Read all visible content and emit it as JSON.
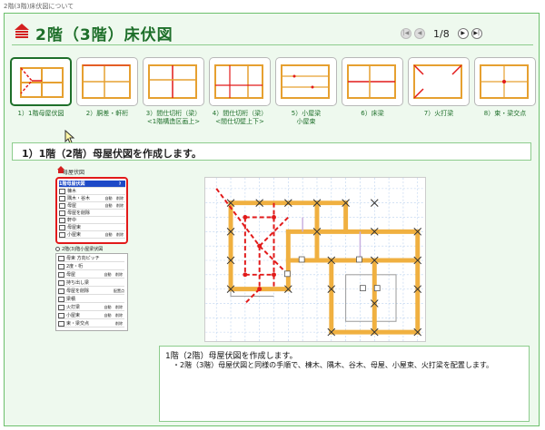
{
  "window": {
    "title": "2階(3階)床伏図について"
  },
  "header": {
    "title": "2階（3階）床伏図"
  },
  "pager": {
    "text": "1/8"
  },
  "thumbnails": [
    {
      "label": "1）1階母屋伏図"
    },
    {
      "label": "2）胴差・軒桁"
    },
    {
      "label": "3）間仕切桁（梁）\n<1階構造区画上>"
    },
    {
      "label": "4）間仕切桁（梁）\n<間仕切壁上下>"
    },
    {
      "label": "5）小屋梁\n小屋束"
    },
    {
      "label": "6）床梁"
    },
    {
      "label": "7）火打梁"
    },
    {
      "label": "8）束・梁交点"
    }
  ],
  "section": {
    "title": "1）1階（2階）母屋伏図を作成します。"
  },
  "panel": {
    "header": "母屋伏図",
    "group1": [
      {
        "name": "1階母屋伏図",
        "act": "",
        "del": "?"
      },
      {
        "name": "棟木",
        "act": "",
        "del": ""
      },
      {
        "name": "隅木・谷木",
        "act": "自動",
        "del": "削除"
      },
      {
        "name": "母屋",
        "act": "自動",
        "del": "削除"
      },
      {
        "name": "母屋を削除",
        "act": "",
        "del": ""
      },
      {
        "name": "軒中",
        "act": "",
        "del": ""
      },
      {
        "name": "母屋束",
        "act": "",
        "del": ""
      },
      {
        "name": "小屋束",
        "act": "自動",
        "del": "削除"
      }
    ],
    "radio_label": "2階(3)階小屋梁伏図",
    "group2": [
      {
        "name": "母束 方向ピッチ",
        "act": "",
        "del": ""
      },
      {
        "name": "2度・桁",
        "act": "",
        "del": ""
      },
      {
        "name": "母屋",
        "act": "自動",
        "del": "削除"
      },
      {
        "name": "持ち出し梁",
        "act": "",
        "del": ""
      },
      {
        "name": "母屋を削除",
        "act": "",
        "del": "配置点"
      },
      {
        "name": "梁積",
        "act": "",
        "del": ""
      },
      {
        "name": "火打梁",
        "act": "自動",
        "del": "削除"
      },
      {
        "name": "小屋束",
        "act": "自動",
        "del": "削除"
      },
      {
        "name": "束・梁交点",
        "act": "",
        "del": "削除"
      }
    ]
  },
  "notes": {
    "title": "1階（2階）母屋伏図を作成します。",
    "body": "・2階（3階）母屋伏図と同様の手順で、棟木、隅木、谷木、母屋、小屋束、火打梁を配置します。"
  }
}
